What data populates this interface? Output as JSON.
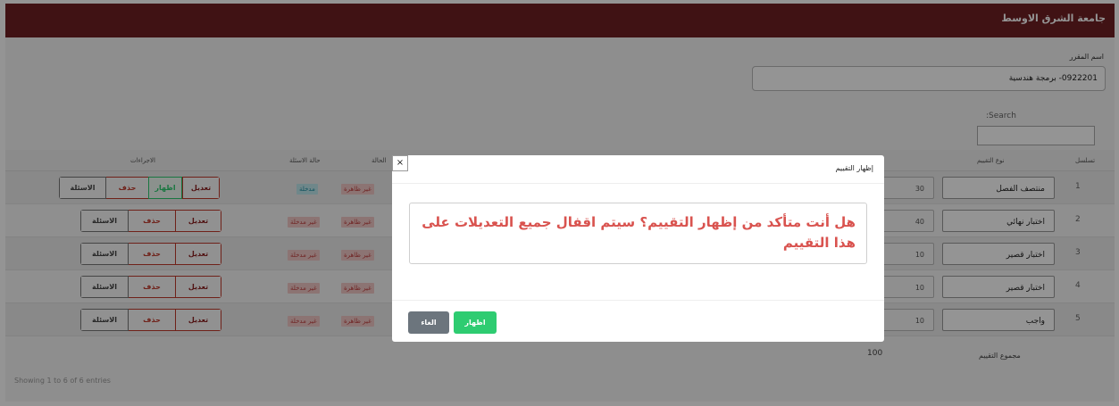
{
  "header": {
    "brand": "جامعة الشرق الاوسط"
  },
  "course": {
    "label": "اسم المقرر",
    "value": "0922201- برمجة هندسية"
  },
  "search": {
    "label": ":Search",
    "value": ""
  },
  "table": {
    "columns": {
      "serial": "تسلسل",
      "type": "نوع التقييم",
      "state": "الحالة",
      "questions_state": "حالة الاسئلة",
      "actions": "الاجراءات"
    },
    "rows": [
      {
        "serial": "1",
        "type": "منتصف الفصل",
        "weight": "30",
        "state": "غير ظاهرة",
        "questions_state": "مدخلة",
        "actions": {
          "edit": "تعديل",
          "show": "اظهار",
          "delete": "حذف",
          "questions": "الاسئلة"
        }
      },
      {
        "serial": "2",
        "type": "اختبار نهائي",
        "weight": "40",
        "state": "غير ظاهرة",
        "questions_state": "غير مدخلة",
        "actions": {
          "edit": "تعديل",
          "delete": "حذف",
          "questions": "الاسئلة"
        }
      },
      {
        "serial": "3",
        "type": "اختبار قصير",
        "weight": "10",
        "state": "غير ظاهرة",
        "questions_state": "غير مدخلة",
        "actions": {
          "edit": "تعديل",
          "delete": "حذف",
          "questions": "الاسئلة"
        }
      },
      {
        "serial": "4",
        "type": "اختبار قصير",
        "weight": "10",
        "state": "غير ظاهرة",
        "questions_state": "غير مدخلة",
        "actions": {
          "edit": "تعديل",
          "delete": "حذف",
          "questions": "الاسئلة"
        }
      },
      {
        "serial": "5",
        "type": "واجب",
        "weight": "10",
        "state": "غير ظاهرة",
        "questions_state": "غير مدخلة",
        "actions": {
          "edit": "تعديل",
          "delete": "حذف",
          "questions": "الاسئلة"
        }
      }
    ],
    "total_label": "مجموع التقييم",
    "total_value": "100",
    "showing": "Showing 1 to 6 of 6 entries"
  },
  "modal": {
    "title": "إظهار التقييم",
    "close": "×",
    "message": "هل أنت متأكد من إظهار التقييم؟ سيتم اقفال جميع التعديلات على هذا التقييم",
    "confirm_label": "اظهار",
    "cancel_label": "الغاء"
  },
  "colors": {
    "brand": "#6f1f24",
    "danger": "#d9534f",
    "success": "#2ecc71",
    "secondary": "#6c757d",
    "info": "#1f8fa2"
  }
}
